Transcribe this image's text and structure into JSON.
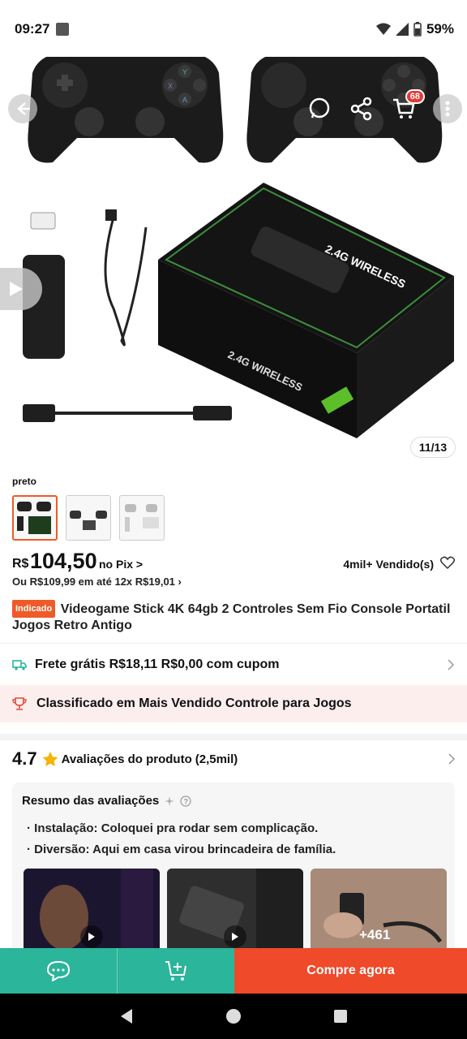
{
  "status_bar": {
    "time": "09:27",
    "battery": "59%"
  },
  "gallery": {
    "counter": "11/13",
    "cart_count": "68"
  },
  "variant": {
    "label": "preto"
  },
  "price": {
    "currency": "R$",
    "value": "104,50",
    "pix_label": "no Pix >",
    "sold": "4mil+ Vendido(s)",
    "installment": "Ou R$109,99 em até 12x R$19,01 ›"
  },
  "product": {
    "tag": "Indicado",
    "title": "Videogame Stick 4K 64gb 2 Controles Sem Fio Console Portatil Jogos Retro Antigo"
  },
  "shipping": {
    "text": "Frete grátis R$18,11 R$0,00 com cupom"
  },
  "ranking": {
    "text": "Classificado em Mais Vendido Controle para Jogos"
  },
  "rating": {
    "score": "4.7",
    "label": "Avaliações do produto",
    "count": "(2,5mil)"
  },
  "summary": {
    "title": "Resumo das avaliações",
    "bullets": [
      "Instalação: Coloquei pra rodar sem complicação.",
      "Diversão: Aqui em casa virou brincadeira de família."
    ],
    "more_media": "+461"
  },
  "bottom_bar": {
    "buy_label": "Compre agora"
  },
  "colors": {
    "accent": "#ef4a2a",
    "teal": "#2bb59a",
    "tag": "#f05a28"
  }
}
